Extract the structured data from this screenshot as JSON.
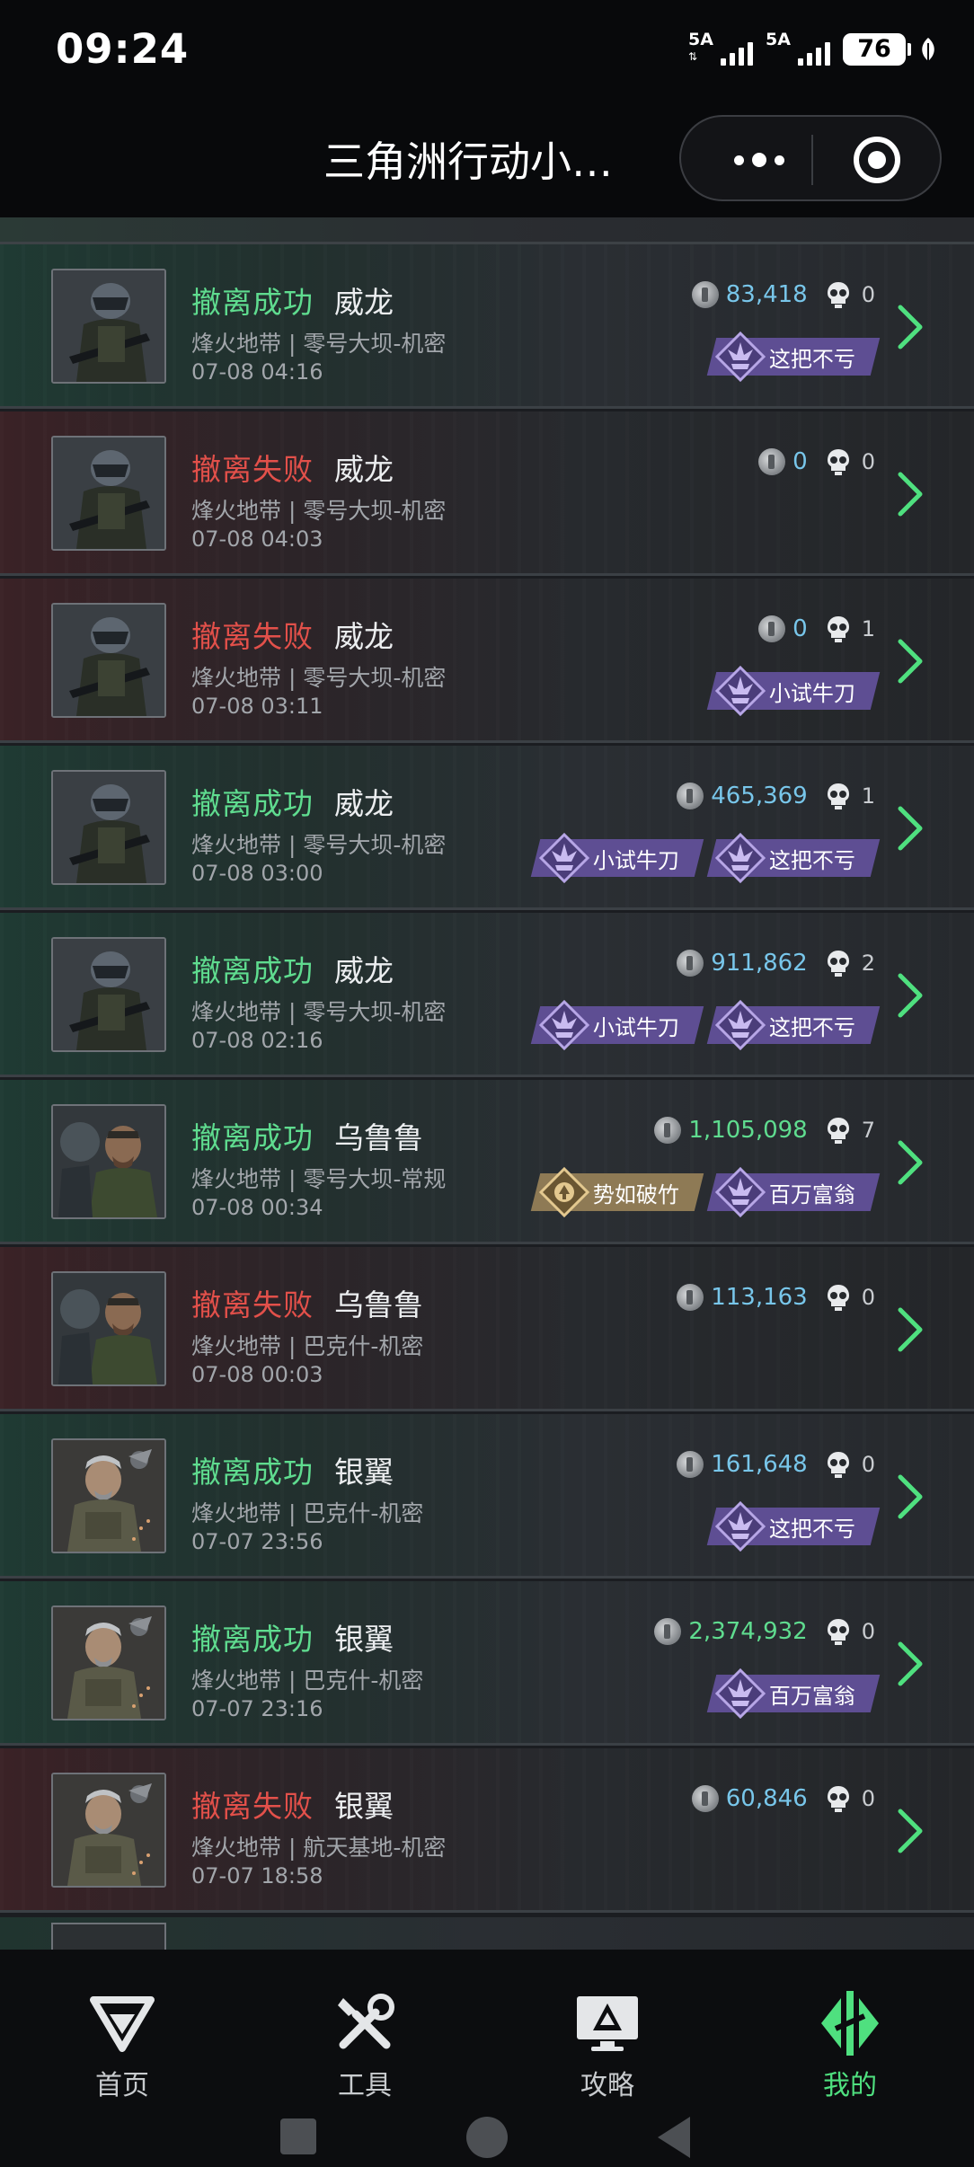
{
  "status_bar": {
    "time": "09:24",
    "sim1": "5A",
    "sim2": "5A",
    "battery": "76"
  },
  "header": {
    "title": "三角洲行动小…"
  },
  "records": [
    {
      "result": "撤离成功",
      "result_type": "success",
      "operator": "威龙",
      "map": "烽火地带 | 零号大坝-机密",
      "time": "07-08 04:16",
      "value": "83,418",
      "value_color": "blue",
      "kills": "0",
      "avatar": "weilong",
      "badges": [
        {
          "label": "这把不亏",
          "style": "purple"
        }
      ]
    },
    {
      "result": "撤离失败",
      "result_type": "fail",
      "operator": "威龙",
      "map": "烽火地带 | 零号大坝-机密",
      "time": "07-08 04:03",
      "value": "0",
      "value_color": "blue",
      "kills": "0",
      "avatar": "weilong",
      "badges": []
    },
    {
      "result": "撤离失败",
      "result_type": "fail",
      "operator": "威龙",
      "map": "烽火地带 | 零号大坝-机密",
      "time": "07-08 03:11",
      "value": "0",
      "value_color": "blue",
      "kills": "1",
      "avatar": "weilong",
      "badges": [
        {
          "label": "小试牛刀",
          "style": "purple"
        }
      ]
    },
    {
      "result": "撤离成功",
      "result_type": "success",
      "operator": "威龙",
      "map": "烽火地带 | 零号大坝-机密",
      "time": "07-08 03:00",
      "value": "465,369",
      "value_color": "blue",
      "kills": "1",
      "avatar": "weilong",
      "badges": [
        {
          "label": "小试牛刀",
          "style": "purple"
        },
        {
          "label": "这把不亏",
          "style": "purple"
        }
      ]
    },
    {
      "result": "撤离成功",
      "result_type": "success",
      "operator": "威龙",
      "map": "烽火地带 | 零号大坝-机密",
      "time": "07-08 02:16",
      "value": "911,862",
      "value_color": "blue",
      "kills": "2",
      "avatar": "weilong",
      "badges": [
        {
          "label": "小试牛刀",
          "style": "purple"
        },
        {
          "label": "这把不亏",
          "style": "purple"
        }
      ]
    },
    {
      "result": "撤离成功",
      "result_type": "success",
      "operator": "乌鲁鲁",
      "map": "烽火地带 | 零号大坝-常规",
      "time": "07-08 00:34",
      "value": "1,105,098",
      "value_color": "green",
      "kills": "7",
      "avatar": "wululu",
      "badges": [
        {
          "label": "势如破竹",
          "style": "gold"
        },
        {
          "label": "百万富翁",
          "style": "purple"
        }
      ]
    },
    {
      "result": "撤离失败",
      "result_type": "fail",
      "operator": "乌鲁鲁",
      "map": "烽火地带 | 巴克什-机密",
      "time": "07-08 00:03",
      "value": "113,163",
      "value_color": "blue",
      "kills": "0",
      "avatar": "wululu",
      "badges": []
    },
    {
      "result": "撤离成功",
      "result_type": "success",
      "operator": "银翼",
      "map": "烽火地带 | 巴克什-机密",
      "time": "07-07 23:56",
      "value": "161,648",
      "value_color": "blue",
      "kills": "0",
      "avatar": "yinyi",
      "badges": [
        {
          "label": "这把不亏",
          "style": "purple"
        }
      ]
    },
    {
      "result": "撤离成功",
      "result_type": "success",
      "operator": "银翼",
      "map": "烽火地带 | 巴克什-机密",
      "time": "07-07 23:16",
      "value": "2,374,932",
      "value_color": "green",
      "kills": "0",
      "avatar": "yinyi",
      "badges": [
        {
          "label": "百万富翁",
          "style": "purple"
        }
      ]
    },
    {
      "result": "撤离失败",
      "result_type": "fail",
      "operator": "银翼",
      "map": "烽火地带 | 航天基地-机密",
      "time": "07-07 18:58",
      "value": "60,846",
      "value_color": "blue",
      "kills": "0",
      "avatar": "yinyi",
      "badges": []
    }
  ],
  "bottom_nav": {
    "items": [
      {
        "label": "首页",
        "icon": "home-logo-icon",
        "active": false
      },
      {
        "label": "工具",
        "icon": "tools-icon",
        "active": false
      },
      {
        "label": "攻略",
        "icon": "guide-monitor-icon",
        "active": false
      },
      {
        "label": "我的",
        "icon": "profile-logo-icon",
        "active": true
      }
    ]
  },
  "colors": {
    "success": "#5fdc8f",
    "fail": "#e2504a",
    "value_blue": "#78c6ea",
    "value_green": "#5fdc8f",
    "badge_purple": "#5e4e93",
    "badge_gold": "#8e7a55",
    "nav_active": "#4fe07f"
  }
}
